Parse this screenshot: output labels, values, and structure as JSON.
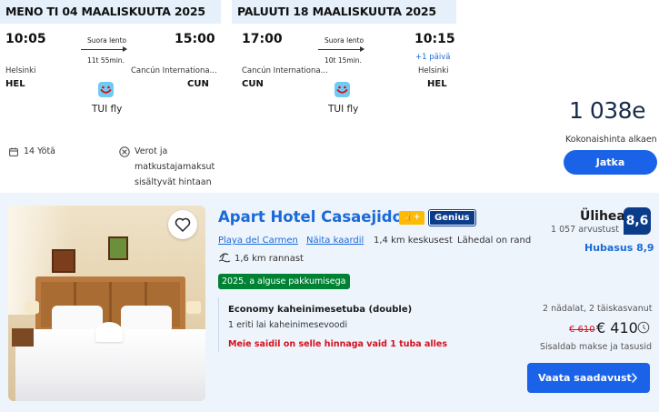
{
  "flight": {
    "outbound": {
      "header": "MENO TI 04 MAALISKUUTA 2025",
      "depart_time": "10:05",
      "arrive_time": "15:00",
      "stop_type": "Suora lento",
      "duration": "11t 55min.",
      "depart_city": "Helsinki",
      "arrive_city": "Cancún Internationa...",
      "depart_code": "HEL",
      "arrive_code": "CUN",
      "airline": "TUI fly"
    },
    "return": {
      "header": "PALUUTI 18 MAALISKUUTA 2025",
      "depart_time": "17:00",
      "arrive_time": "10:15",
      "stop_type": "Suora lento",
      "duration": "10t 15min.",
      "day_offset": "+1 päivä",
      "depart_city": "Cancún Internationa...",
      "arrive_city": "Helsinki",
      "depart_code": "CUN",
      "arrive_code": "HEL",
      "airline": "TUI fly"
    },
    "nights": "14 Yötä",
    "taxes_line1": "Verot ja",
    "taxes_line2": "matkustajamaksut",
    "taxes_line3": "sisältyvät hintaan",
    "price": "1 038e",
    "price_caption": "Kokonaishinta alkaen",
    "continue_label": "Jatka",
    "icons": {
      "calendar": "calendar-icon",
      "no_fees": "no-fees-icon",
      "airline_logo": "tui-smile-logo"
    }
  },
  "hotel": {
    "name": "Apart Hotel Casaejido",
    "genius_label": "Genius",
    "location_link": "Playa del Carmen",
    "map_link": "Näita kaardil",
    "distance_center": "1,4 km keskusest",
    "near_sea": "Lähedal on rand",
    "beach_distance": "1,6 km rannast",
    "deal_badge": "2025. a alguse pakkumisega",
    "room_type": "Economy kaheinimesetuba (double)",
    "bed_type": "1 eriti lai kaheinimesevoodi",
    "scarcity": "Meie saidil on selle hinnaga vaid 1 tuba alles",
    "score_word": "Ülihea",
    "reviews": "1 057 arvustust",
    "score": "8,6",
    "comfort": "Hubasus 8,9",
    "stay_info": "2 nädalat, 2 täiskasvanut",
    "old_price": "€ 610",
    "new_price": "€ 410",
    "includes": "Sisaldab makse ja tasusid",
    "cta_label": "Vaata saadavust",
    "colors": {
      "accent": "#1a6ad8",
      "genius": "#0b3c8a",
      "deal": "#008234",
      "alert": "#d4111e"
    }
  }
}
